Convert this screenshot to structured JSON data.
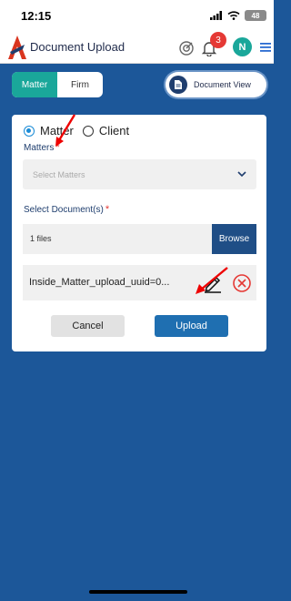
{
  "status_bar": {
    "time": "12:15",
    "battery": "48"
  },
  "header": {
    "title": "Document Upload",
    "notification_count": "3",
    "avatar_initial": "N"
  },
  "toggle": {
    "options": [
      "Matter",
      "Firm"
    ],
    "active": "Matter"
  },
  "document_view": {
    "label": "Document View"
  },
  "form": {
    "radio_options": [
      "Matter",
      "Client"
    ],
    "radio_selected": "Matter",
    "matters_label": "Matters",
    "matters_required": "*",
    "matters_placeholder": "Select Matters",
    "documents_label": "Select Document(s)",
    "documents_required": "*",
    "file_count": "1 files",
    "browse_label": "Browse",
    "file_name": "Inside_Matter_upload_uuid=0...",
    "cancel_label": "Cancel",
    "upload_label": "Upload"
  },
  "colors": {
    "background": "#1c5799",
    "teal": "#1aa79a",
    "browse": "#1f4e86",
    "upload": "#1f6fb1",
    "required": "#e53935"
  },
  "icons": [
    "wifi-icon",
    "signal-icon",
    "battery-icon",
    "logo-icon",
    "analytics-icon",
    "bell-icon",
    "menu-icon",
    "document-icon",
    "chevron-down-icon",
    "edit-icon",
    "remove-icon"
  ]
}
